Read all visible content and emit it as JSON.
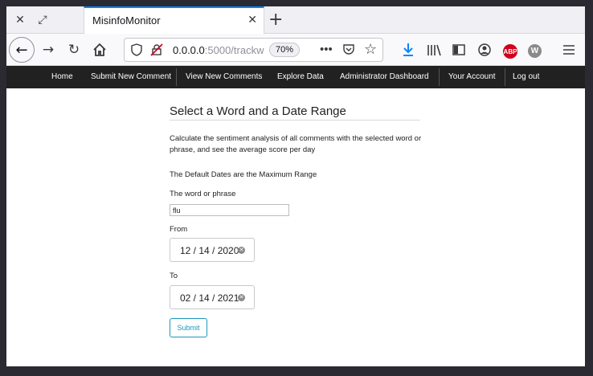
{
  "browser": {
    "tab_title": "MisinfoMonitor",
    "url_host": "0.0.0.0",
    "url_rest": ":5000/trackw",
    "zoom": "70%",
    "abp_label": "ABP",
    "w_label": "W"
  },
  "nav": {
    "items": [
      "Home",
      "Submit New Comment",
      "View New Comments",
      "Explore Data",
      "Administrator Dashboard",
      "Your Account",
      "Log out"
    ]
  },
  "form": {
    "heading": "Select a Word and a Date Range",
    "description": "Calculate the sentiment analysis of all comments with the selected word or phrase, and see the average score per day",
    "default_note": "The Default Dates are the Maximum Range",
    "word_label": "The word or phrase",
    "word_value": "flu",
    "from_label": "From",
    "from_value": "12 / 14 / 2020",
    "to_label": "To",
    "to_value": "02 / 14 / 2021",
    "submit_label": "Submit"
  }
}
